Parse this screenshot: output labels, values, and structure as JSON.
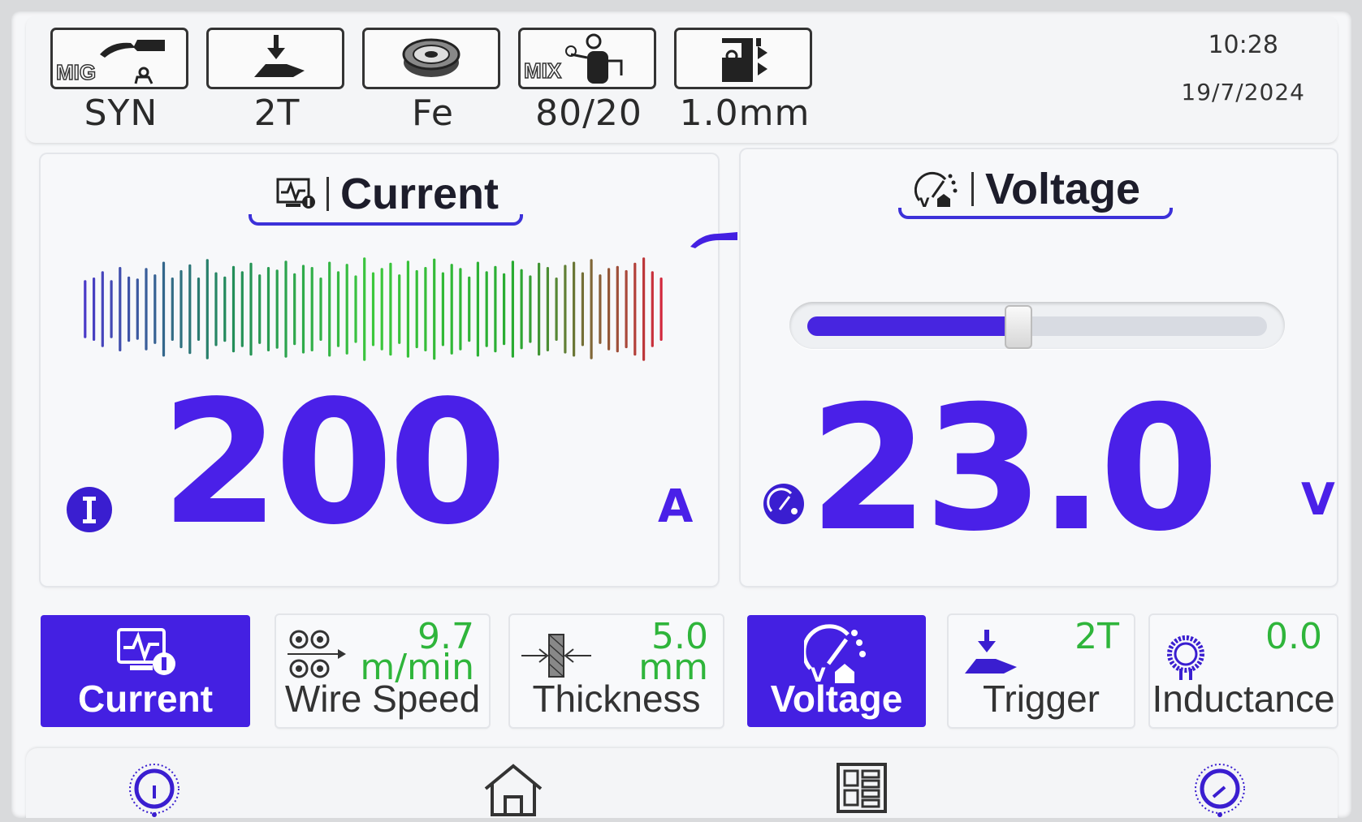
{
  "status_bar": {
    "items": [
      {
        "icon": "mig-torch-icon",
        "box_text": "MIG",
        "label": "SYN"
      },
      {
        "icon": "trigger-icon",
        "label": "2T"
      },
      {
        "icon": "wire-spool-icon",
        "label": "Fe"
      },
      {
        "icon": "gas-cylinder-icon",
        "box_text": "MIX",
        "label": "80/20"
      },
      {
        "icon": "wire-diameter-icon",
        "label": "1.0mm"
      }
    ],
    "time": "10:28",
    "date": "19/7/2024"
  },
  "current_panel": {
    "title": "Current",
    "value": "200",
    "unit": "A",
    "waveform_levels": [
      0.55,
      0.6,
      0.72,
      0.55,
      0.8,
      0.62,
      0.58,
      0.78,
      0.66,
      0.9,
      0.6,
      0.74,
      0.85,
      0.6,
      0.95,
      0.7,
      0.62,
      0.82,
      0.72,
      0.88,
      0.66,
      0.8,
      0.75,
      0.92,
      0.68,
      0.84,
      0.8,
      0.6,
      0.9,
      0.72,
      0.86,
      0.64,
      0.98,
      0.7,
      0.78,
      0.88,
      0.66,
      0.92,
      0.74,
      0.8,
      0.96,
      0.7,
      0.86,
      0.78,
      0.62,
      0.9,
      0.72,
      0.82,
      0.68,
      0.92,
      0.76,
      0.64,
      0.88,
      0.8,
      0.6,
      0.84,
      0.9,
      0.7,
      0.95,
      0.66,
      0.78,
      0.82,
      0.74,
      0.88,
      0.98,
      0.72,
      0.6
    ]
  },
  "voltage_panel": {
    "title": "Voltage",
    "value": "23.0",
    "unit": "V",
    "slider_level": 0.46
  },
  "params": [
    {
      "id": "current",
      "label": "Current",
      "value": "",
      "unit": "",
      "icon": "current-monitor-icon",
      "active": true
    },
    {
      "id": "wire-speed",
      "label": "Wire Speed",
      "value": "9.7",
      "unit": "m/min",
      "icon": "wire-feed-rollers-icon",
      "active": false
    },
    {
      "id": "thickness",
      "label": "Thickness",
      "value": "5.0",
      "unit": "mm",
      "icon": "thickness-icon",
      "active": false
    },
    {
      "id": "voltage",
      "label": "Voltage",
      "value": "",
      "unit": "",
      "icon": "voltage-gauge-icon",
      "active": true
    },
    {
      "id": "trigger",
      "label": "Trigger",
      "value": "2T",
      "unit": "",
      "icon": "trigger-icon",
      "active": false
    },
    {
      "id": "inductance",
      "label": "Inductance",
      "value": "0.0",
      "unit": "",
      "icon": "inductance-coil-icon",
      "active": false
    }
  ],
  "bottom_bar": {
    "items": [
      "left-knob-icon",
      "home-icon",
      "menu-grid-icon",
      "right-knob-icon"
    ]
  },
  "colors": {
    "accent": "#4420e2",
    "value_green": "#2fb53b",
    "background": "#f6f7f9"
  }
}
